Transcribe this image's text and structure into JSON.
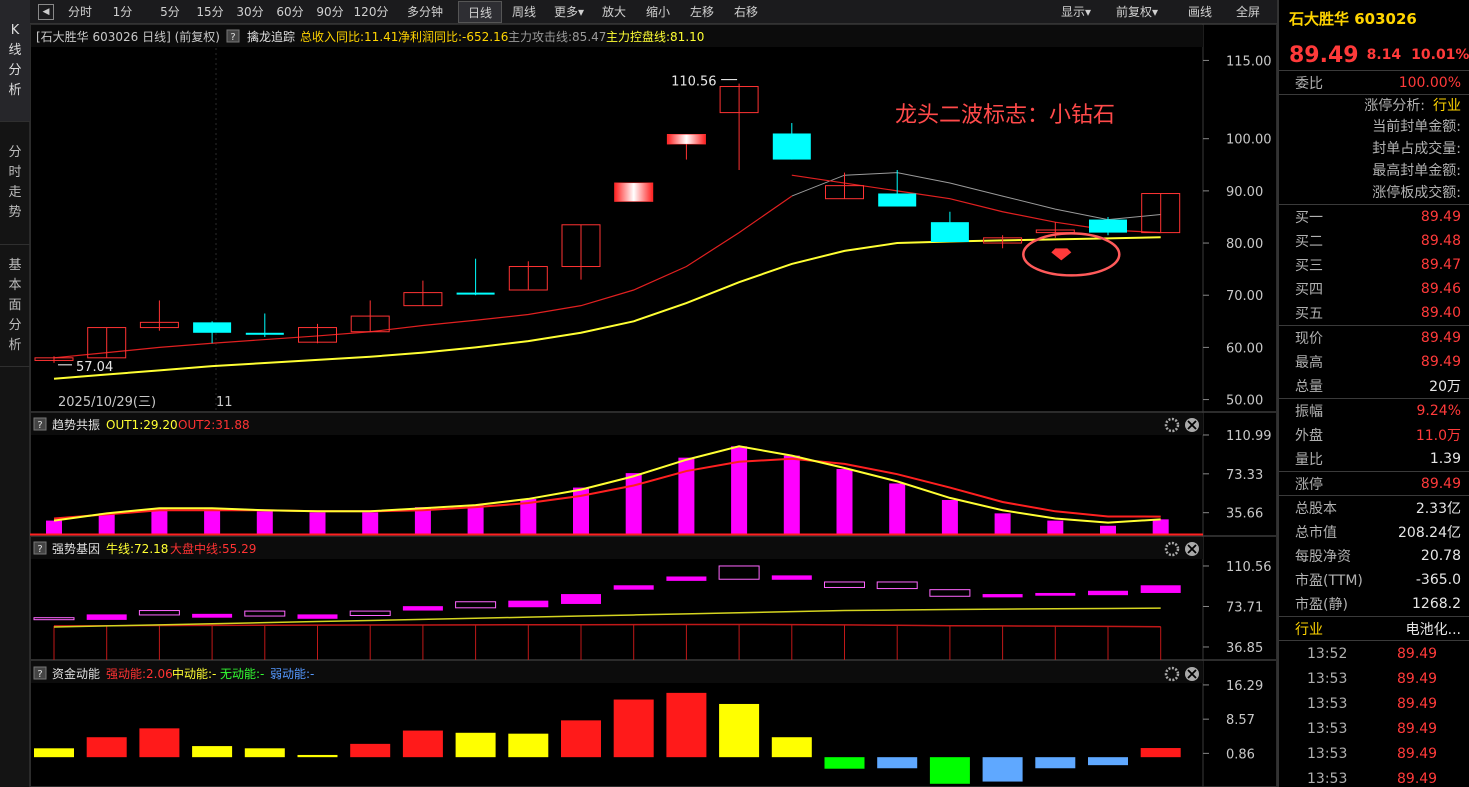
{
  "left_tabs": [
    {
      "label": "K线分析",
      "active": true
    },
    {
      "label": "分时走势",
      "active": false
    },
    {
      "label": "基本面分析",
      "active": false
    }
  ],
  "toolbar": {
    "collapse_icon": "◀",
    "buttons": [
      {
        "label": "分时"
      },
      {
        "label": "1分"
      },
      {
        "label": "5分"
      },
      {
        "label": "15分"
      },
      {
        "label": "30分"
      },
      {
        "label": "60分"
      },
      {
        "label": "90分"
      },
      {
        "label": "120分"
      },
      {
        "label": "多分钟"
      },
      {
        "label": "日线",
        "active": true
      },
      {
        "label": "周线"
      },
      {
        "label": "更多▾"
      },
      {
        "label": "放大"
      },
      {
        "label": "缩小"
      },
      {
        "label": "左移"
      },
      {
        "label": "右移"
      }
    ],
    "right_buttons": [
      {
        "label": "显示▾"
      },
      {
        "label": "前复权▾"
      },
      {
        "label": "画线"
      },
      {
        "label": "全屏"
      }
    ]
  },
  "main_info": {
    "prefix": "[石大胜华 603026 日线]  (前复权)",
    "indicator": "擒龙追踪",
    "item1": "总收入同比:11.41",
    "item2": "净利润同比:-652.16",
    "item3": "主力攻击线:85.47",
    "item4": "主力控盘线:81.10"
  },
  "annotations": {
    "title": "龙头二波标志：小钻石",
    "high_label": "110.56",
    "low_label": "57.04",
    "date_label": "2025/10/29(三)",
    "month_label": "11"
  },
  "colors": {
    "up": "#ff3333",
    "down": "#00ffff",
    "ma_red": "#e02020",
    "ma_yellow": "#ffff33",
    "ma_gray": "#9a9a9a",
    "magenta": "#ff00ff",
    "panel_bg": "#000000",
    "grid": "#2a2a2a"
  },
  "chart_data": [
    {
      "type": "candlestick",
      "name": "price",
      "y_ticks": [
        "115.00",
        "100.00",
        "90.00",
        "80.00",
        "70.00",
        "60.00",
        "50.00"
      ],
      "candles": [
        {
          "o": 57.5,
          "c": 58.0,
          "h": 58.3,
          "l": 57.04
        },
        {
          "o": 58.0,
          "c": 63.8,
          "h": 63.8,
          "l": 58.0
        },
        {
          "o": 63.8,
          "c": 64.8,
          "h": 69.0,
          "l": 63.2
        },
        {
          "o": 64.8,
          "c": 62.8,
          "h": 65.0,
          "l": 60.8
        },
        {
          "o": 62.8,
          "c": 62.5,
          "h": 66.5,
          "l": 62.0
        },
        {
          "o": 61.0,
          "c": 63.8,
          "h": 64.5,
          "l": 60.8
        },
        {
          "o": 63.0,
          "c": 66.0,
          "h": 69.0,
          "l": 63.0
        },
        {
          "o": 68.0,
          "c": 70.5,
          "h": 72.8,
          "l": 68.0
        },
        {
          "o": 70.5,
          "c": 70.4,
          "h": 77.0,
          "l": 70.0
        },
        {
          "o": 71.0,
          "c": 75.5,
          "h": 76.5,
          "l": 71.0
        },
        {
          "o": 75.5,
          "c": 83.5,
          "h": 83.5,
          "l": 73.0
        },
        {
          "o": 88.0,
          "c": 91.5,
          "h": 91.5,
          "l": 88.0
        },
        {
          "o": 99.0,
          "c": 100.8,
          "h": 100.8,
          "l": 96.0
        },
        {
          "o": 105.0,
          "c": 110.0,
          "h": 110.56,
          "l": 94.0
        },
        {
          "o": 101.0,
          "c": 96.0,
          "h": 103.0,
          "l": 96.0
        },
        {
          "o": 88.5,
          "c": 91.0,
          "h": 93.5,
          "l": 88.5
        },
        {
          "o": 89.5,
          "c": 87.0,
          "h": 94.0,
          "l": 87.0
        },
        {
          "o": 84.0,
          "c": 80.2,
          "h": 86.0,
          "l": 80.2
        },
        {
          "o": 80.0,
          "c": 81.0,
          "h": 81.5,
          "l": 79.0
        },
        {
          "o": 82.0,
          "c": 82.5,
          "h": 84.0,
          "l": 81.0
        },
        {
          "o": 84.5,
          "c": 82.0,
          "h": 85.0,
          "l": 81.5
        },
        {
          "o": 82.0,
          "c": 89.49,
          "h": 89.49,
          "l": 82.0
        }
      ],
      "ma_red": [
        58.0,
        59.0,
        60.0,
        60.8,
        61.5,
        62.2,
        63.0,
        64.2,
        65.2,
        66.3,
        68.0,
        71.0,
        75.5,
        82.0,
        89.0,
        93.0,
        93.5,
        91.5,
        89.0,
        86.5,
        84.5,
        85.47
      ],
      "ma_yellow": [
        54.0,
        54.8,
        55.6,
        56.4,
        57.0,
        57.6,
        58.2,
        59.0,
        60.0,
        61.2,
        62.8,
        65.0,
        68.5,
        72.5,
        76.0,
        78.5,
        80.0,
        80.3,
        80.5,
        80.7,
        80.9,
        81.1
      ]
    },
    {
      "type": "bar",
      "name": "趋势共振",
      "labels": {
        "out1": "OUT1:29.20",
        "out2": "OUT2:31.88"
      },
      "y_ticks": [
        "110.99",
        "73.33",
        "35.66"
      ],
      "values": [
        28,
        35,
        40,
        39,
        37,
        36,
        36,
        41,
        43,
        49,
        60,
        74,
        89,
        100,
        91,
        78,
        64,
        48,
        35,
        28,
        23,
        29.2
      ],
      "line_yellow": [
        28,
        35,
        40,
        40,
        38,
        37,
        37,
        40,
        43,
        49,
        58,
        71,
        87,
        100,
        91,
        79,
        66,
        50,
        38,
        30,
        26,
        29.2
      ],
      "line_red": [
        30,
        34,
        38,
        38,
        38,
        37,
        37,
        38,
        41,
        45,
        52,
        62,
        76,
        85,
        88,
        83,
        73,
        60,
        46,
        37,
        32,
        31.88
      ]
    },
    {
      "type": "bar",
      "name": "强势基因",
      "labels": {
        "l1": "牛线:72.18",
        "l2": "大盘中线:55.29"
      },
      "y_ticks": [
        "110.56",
        "73.71",
        "36.85"
      ],
      "boxes": [
        {
          "top": 63.5,
          "bot": 62.0,
          "solid": false
        },
        {
          "top": 66.5,
          "bot": 61.5,
          "solid": true
        },
        {
          "top": 70.0,
          "bot": 66.0,
          "solid": false
        },
        {
          "top": 67.0,
          "bot": 63.5,
          "solid": true
        },
        {
          "top": 69.5,
          "bot": 65.0,
          "solid": false
        },
        {
          "top": 66.5,
          "bot": 62.5,
          "solid": true
        },
        {
          "top": 69.5,
          "bot": 65.5,
          "solid": false
        },
        {
          "top": 74.0,
          "bot": 70.0,
          "solid": true
        },
        {
          "top": 78.0,
          "bot": 72.5,
          "solid": false
        },
        {
          "top": 79.0,
          "bot": 73.0,
          "solid": true
        },
        {
          "top": 85.0,
          "bot": 76.0,
          "solid": true
        },
        {
          "top": 93.0,
          "bot": 89.0,
          "solid": true
        },
        {
          "top": 101.0,
          "bot": 97.0,
          "solid": true
        },
        {
          "top": 110.56,
          "bot": 98.5,
          "solid": false
        },
        {
          "top": 102.0,
          "bot": 98.0,
          "solid": true
        },
        {
          "top": 96.0,
          "bot": 91.0,
          "solid": false
        },
        {
          "top": 96.0,
          "bot": 90.0,
          "solid": false
        },
        {
          "top": 89.0,
          "bot": 83.0,
          "solid": false
        },
        {
          "top": 85.0,
          "bot": 82.0,
          "solid": true
        },
        {
          "top": 86.0,
          "bot": 83.5,
          "solid": true
        },
        {
          "top": 88.0,
          "bot": 84.0,
          "solid": true
        },
        {
          "top": 93.0,
          "bot": 86.0,
          "solid": true
        }
      ],
      "line_yellow": [
        55,
        56,
        57,
        58,
        59,
        60,
        61,
        62,
        63,
        64,
        65,
        66,
        67,
        68,
        69,
        70,
        70.5,
        71,
        71.3,
        71.6,
        71.9,
        72.18
      ],
      "line_red": [
        56.0,
        56.2,
        56.4,
        56.5,
        56.6,
        56.7,
        56.8,
        56.9,
        57.0,
        57.1,
        57.1,
        57.2,
        57.3,
        57.3,
        57.2,
        57.0,
        56.6,
        56.2,
        56.0,
        55.8,
        55.6,
        55.29
      ]
    },
    {
      "type": "bar",
      "name": "资金动能",
      "labels": {
        "strong": "强动能:2.06",
        "mid": "中动能:-",
        "none": "无动能:-",
        "weak": "弱动能:-"
      },
      "y_ticks": [
        "16.29",
        "8.57",
        "0.86"
      ],
      "values": [
        2.0,
        4.5,
        6.5,
        2.5,
        2.0,
        0.5,
        3.0,
        6.0,
        5.5,
        5.3,
        8.3,
        13.0,
        14.5,
        12.0,
        4.5,
        -2.6,
        -2.5,
        -6.0,
        -5.5,
        -2.5,
        -1.8,
        2.06
      ],
      "bar_colors": [
        "yellow",
        "red",
        "red",
        "yellow",
        "yellow",
        "yellow",
        "red",
        "red",
        "yellow",
        "yellow",
        "red",
        "red",
        "red",
        "yellow",
        "yellow",
        "green",
        "blue",
        "green",
        "blue",
        "blue",
        "blue",
        "red"
      ]
    }
  ],
  "right_panel": {
    "title": "石大胜华 603026",
    "price": "89.49",
    "change": "8.14",
    "pct": "10.01%",
    "weibi_label": "委比",
    "weibi_value": "100.00%",
    "zt_analysis_label": "涨停分析:",
    "zt_analysis_value": "行业",
    "zt_lines": [
      "当前封单金额:",
      "封单占成交量:",
      "最高封单金额:",
      "涨停板成交额:"
    ],
    "bids": [
      {
        "label": "买一",
        "value": "89.49"
      },
      {
        "label": "买二",
        "value": "89.48"
      },
      {
        "label": "买三",
        "value": "89.47"
      },
      {
        "label": "买四",
        "value": "89.46"
      },
      {
        "label": "买五",
        "value": "89.40"
      }
    ],
    "stats1": [
      {
        "label": "现价",
        "value": "89.49",
        "color": "red"
      },
      {
        "label": "最高",
        "value": "89.49",
        "color": "red"
      },
      {
        "label": "总量",
        "value": "20万",
        "color": "white"
      }
    ],
    "stats2": [
      {
        "label": "振幅",
        "value": "9.24%",
        "color": "red"
      },
      {
        "label": "外盘",
        "value": "11.0万",
        "color": "red"
      },
      {
        "label": "量比",
        "value": "1.39",
        "color": "white"
      }
    ],
    "zhangting": {
      "label": "涨停",
      "value": "89.49"
    },
    "stats3": [
      {
        "label": "总股本",
        "value": "2.33亿"
      },
      {
        "label": "总市值",
        "value": "208.24亿"
      },
      {
        "label": "每股净资",
        "value": "20.78"
      },
      {
        "label": "市盈(TTM)",
        "value": "-365.0"
      },
      {
        "label": "市盈(静)",
        "value": "1268.2"
      }
    ],
    "industry": {
      "label": "行业",
      "value": "电池化..."
    },
    "ticks": [
      {
        "time": "13:52",
        "price": "89.49"
      },
      {
        "time": "13:53",
        "price": "89.49"
      },
      {
        "time": "13:53",
        "price": "89.49"
      },
      {
        "time": "13:53",
        "price": "89.49"
      },
      {
        "time": "13:53",
        "price": "89.49"
      },
      {
        "time": "13:53",
        "price": "89.49"
      }
    ]
  }
}
